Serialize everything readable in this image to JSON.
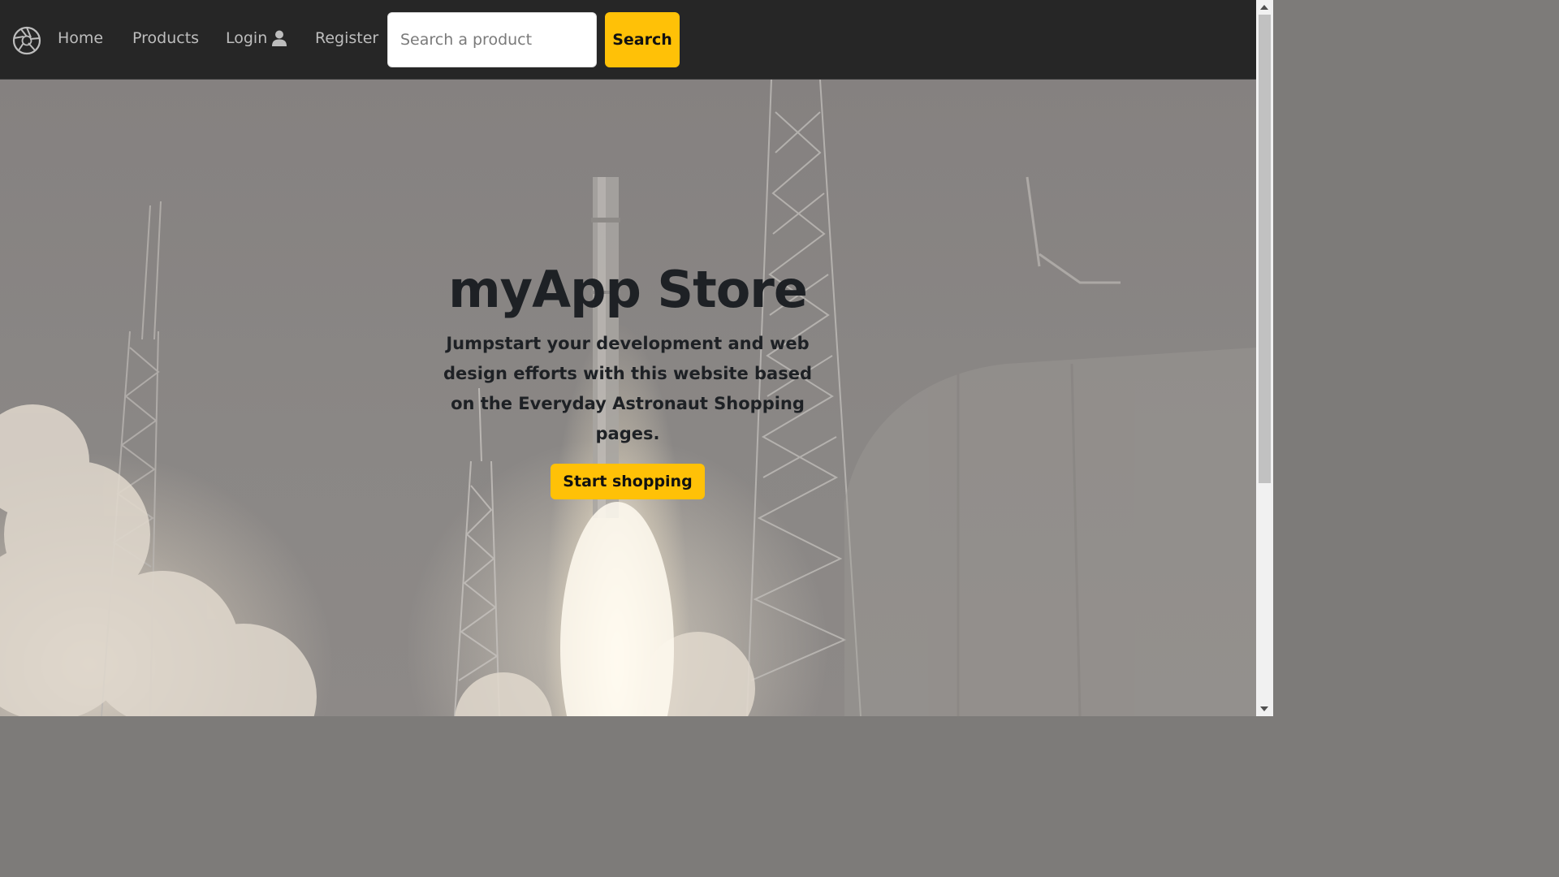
{
  "navbar": {
    "logo_icon": "camera-aperture-icon",
    "links": {
      "home": "Home",
      "products": "Products",
      "login": "Login",
      "register": "Register"
    },
    "login_icon": "user-icon",
    "search": {
      "placeholder": "Search a product",
      "button_label": "Search"
    }
  },
  "hero": {
    "title": "myApp Store",
    "subtitle": "Jumpstart your development and web design efforts with this website based on the Everyday Astronaut Shopping pages.",
    "cta_label": "Start shopping",
    "background": "rocket-launch-photo"
  },
  "colors": {
    "navbar_bg": "#262626",
    "accent": "#ffc107",
    "text_dark": "#1e2125"
  }
}
